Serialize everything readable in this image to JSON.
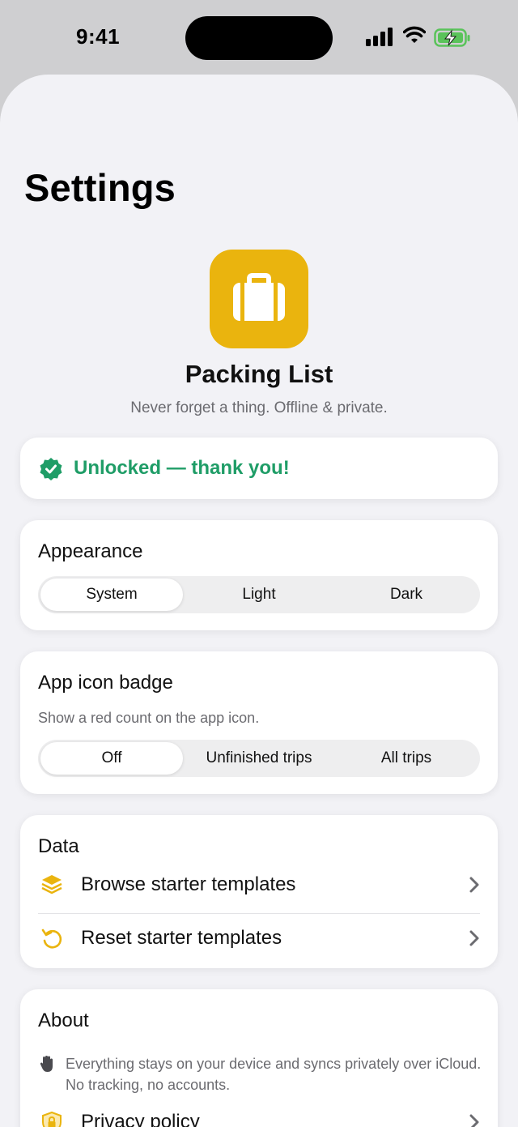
{
  "status_bar": {
    "time": "9:41"
  },
  "header": {
    "title": "Settings"
  },
  "app": {
    "name": "Packing List",
    "tagline": "Never forget a thing. Offline & private.",
    "icon": "suitcase-icon",
    "icon_color": "#eab40e"
  },
  "unlocked": {
    "label": "Unlocked — thank you!",
    "icon": "verified-badge-icon",
    "color": "#1f9d67"
  },
  "appearance": {
    "title": "Appearance",
    "options": [
      "System",
      "Light",
      "Dark"
    ],
    "selected": "System"
  },
  "badge": {
    "title": "App icon badge",
    "subtitle": "Show a red count on the app icon.",
    "options": [
      "Off",
      "Unfinished trips",
      "All trips"
    ],
    "selected": "Off"
  },
  "data_section": {
    "title": "Data",
    "rows": [
      {
        "label": "Browse starter templates",
        "icon": "layers-icon"
      },
      {
        "label": "Reset starter templates",
        "icon": "reset-icon"
      }
    ]
  },
  "about": {
    "title": "About",
    "note": "Everything stays on your device and syncs privately over iCloud. No tracking, no accounts.",
    "note_icon": "hand-icon",
    "rows": [
      {
        "label": "Privacy policy",
        "icon": "lock-shield-icon"
      }
    ]
  }
}
